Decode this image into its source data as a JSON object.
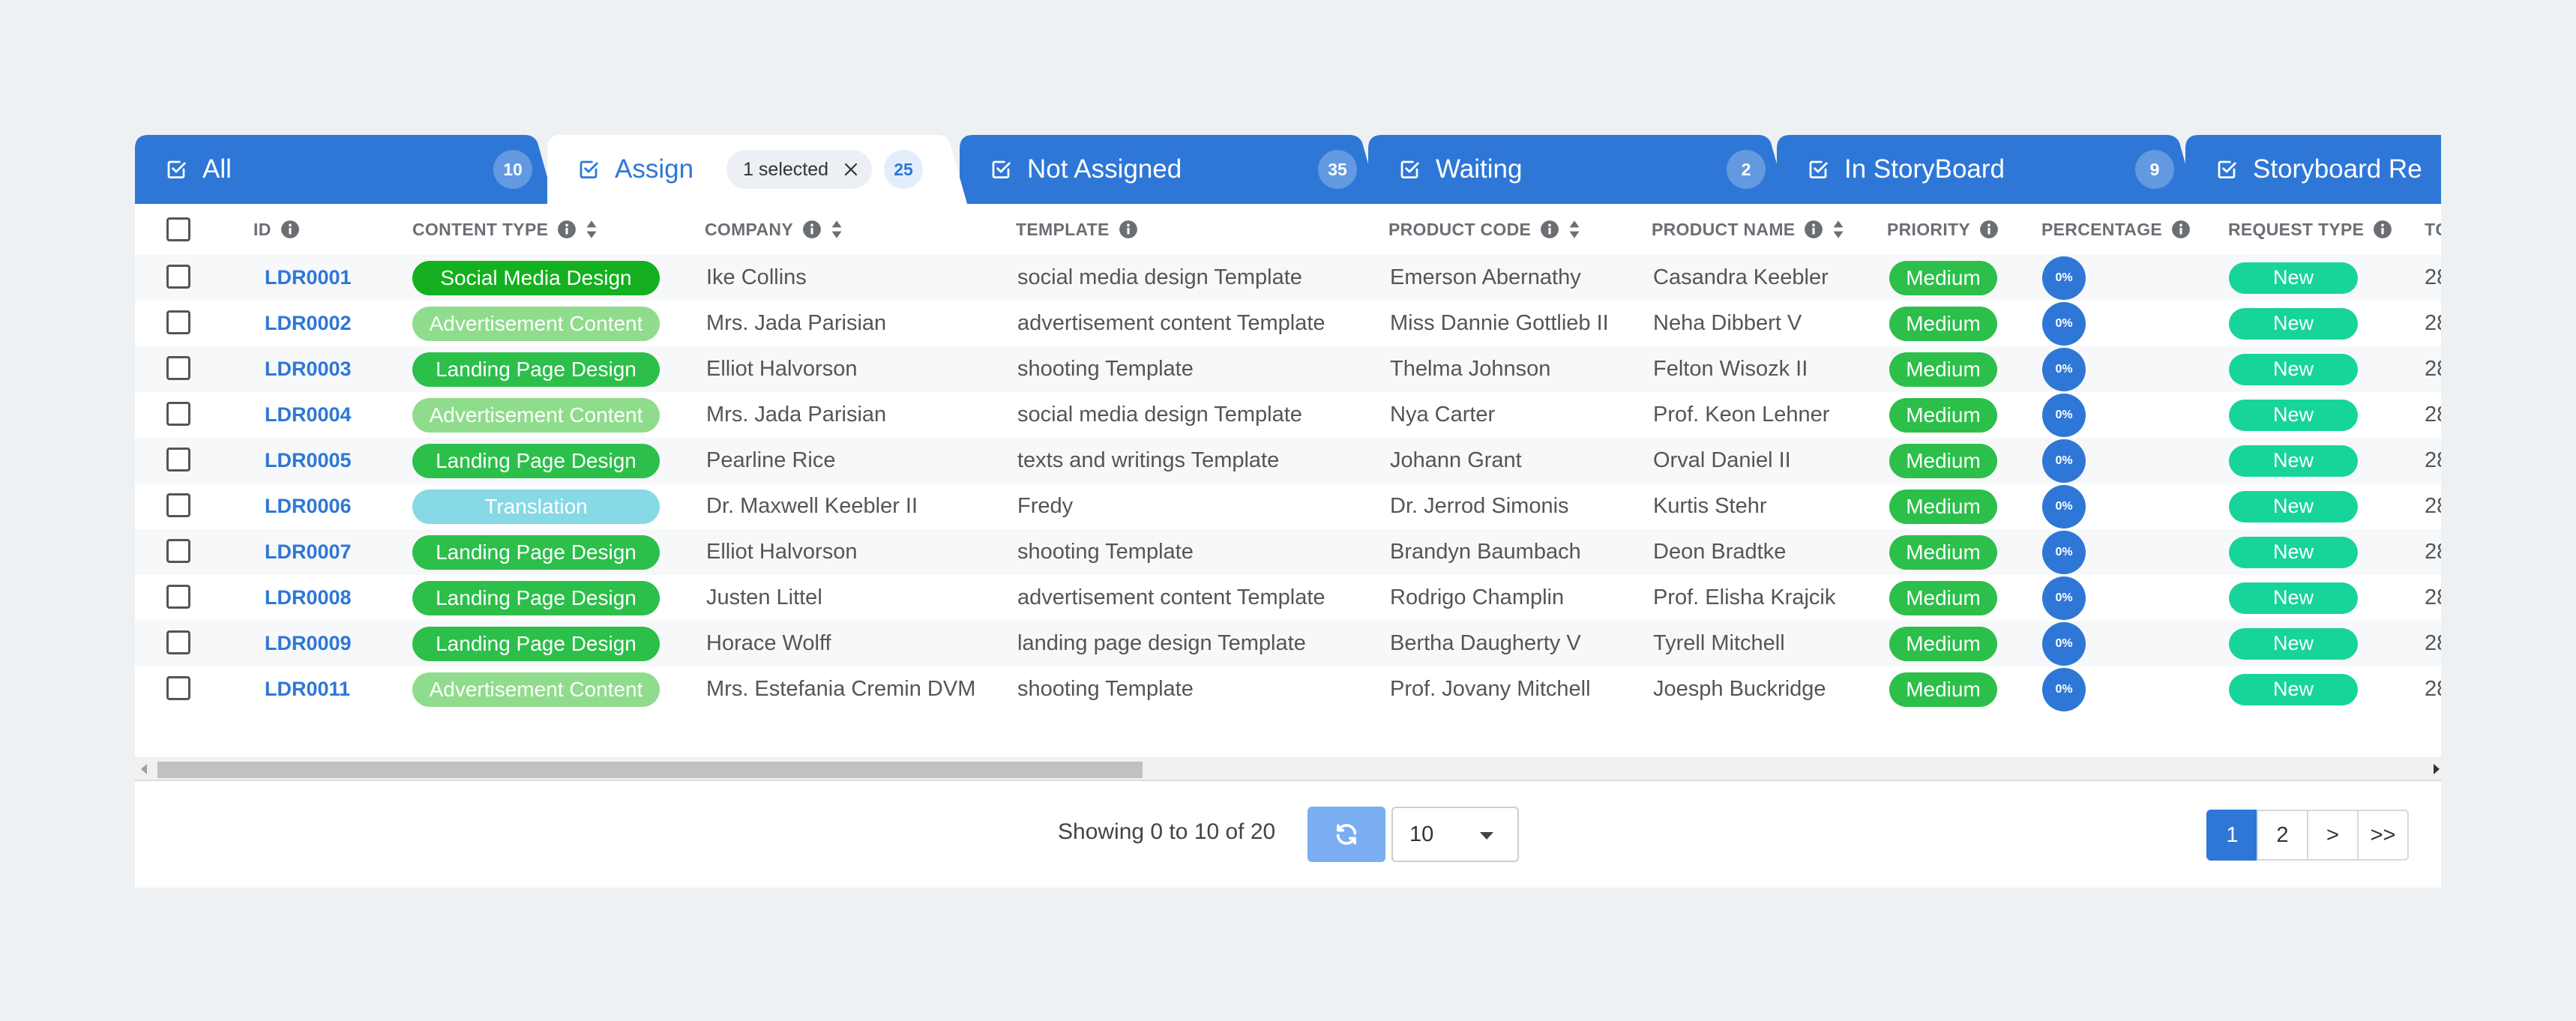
{
  "colors": {
    "tab_blue": "#2e77d6",
    "link_blue": "#2e77d6",
    "ct_dark_green": "#1fb22e",
    "ct_light_green": "#8fdc8c",
    "ct_cyan": "#86d9e5",
    "priority_green": "#2cbf4a",
    "request_teal": "#17d49a",
    "pct_blue": "#2e77d6"
  },
  "tabs": [
    {
      "label": "All",
      "count": "10",
      "active": false,
      "icon": "checkbox-icon"
    },
    {
      "label": "Assign",
      "count": "25",
      "active": true,
      "selected_chip": "1 selected",
      "icon": "checkbox-icon"
    },
    {
      "label": "Not Assigned",
      "count": "35",
      "active": false,
      "icon": "checkbox-icon"
    },
    {
      "label": "Waiting",
      "count": "2",
      "active": false,
      "icon": "checkbox-icon"
    },
    {
      "label": "In StoryBoard",
      "count": "9",
      "active": false,
      "icon": "checkbox-icon"
    },
    {
      "label": "Storyboard Re",
      "count": "",
      "active": false,
      "icon": "checkbox-icon"
    }
  ],
  "table": {
    "columns": [
      {
        "key": "id",
        "label": "ID",
        "info": true,
        "sort": false
      },
      {
        "key": "content_type",
        "label": "CONTENT TYPE",
        "info": true,
        "sort": true
      },
      {
        "key": "company",
        "label": "COMPANY",
        "info": true,
        "sort": true
      },
      {
        "key": "template",
        "label": "TEMPLATE",
        "info": true,
        "sort": false
      },
      {
        "key": "product_code",
        "label": "PRODUCT CODE",
        "info": true,
        "sort": true
      },
      {
        "key": "product_name",
        "label": "PRODUCT NAME",
        "info": true,
        "sort": true
      },
      {
        "key": "priority",
        "label": "PRIORITY",
        "info": true,
        "sort": false
      },
      {
        "key": "percentage",
        "label": "PERCENTAGE",
        "info": true,
        "sort": false
      },
      {
        "key": "request_type",
        "label": "REQUEST TYPE",
        "info": true,
        "sort": false
      },
      {
        "key": "next",
        "label": "TC",
        "info": false,
        "sort": false
      }
    ],
    "rows": [
      {
        "id": "LDR0001",
        "content_type": "Social Media Design",
        "ct_style": "dark",
        "company": "Ike Collins",
        "template": "social media design Template",
        "product_code": "Emerson Abernathy",
        "product_name": "Casandra Keebler",
        "priority": "Medium",
        "percentage": "0%",
        "request_type": "New",
        "next": "28"
      },
      {
        "id": "LDR0002",
        "content_type": "Advertisement Content",
        "ct_style": "light",
        "company": "Mrs. Jada Parisian",
        "template": "advertisement content Template",
        "product_code": "Miss Dannie Gottlieb II",
        "product_name": "Neha Dibbert V",
        "priority": "Medium",
        "percentage": "0%",
        "request_type": "New",
        "next": "28"
      },
      {
        "id": "LDR0003",
        "content_type": "Landing Page Design",
        "ct_style": "mid",
        "company": "Elliot Halvorson",
        "template": "shooting Template",
        "product_code": "Thelma Johnson",
        "product_name": "Felton Wisozk II",
        "priority": "Medium",
        "percentage": "0%",
        "request_type": "New",
        "next": "28"
      },
      {
        "id": "LDR0004",
        "content_type": "Advertisement Content",
        "ct_style": "light",
        "company": "Mrs. Jada Parisian",
        "template": "social media design Template",
        "product_code": "Nya Carter",
        "product_name": "Prof. Keon Lehner",
        "priority": "Medium",
        "percentage": "0%",
        "request_type": "New",
        "next": "28"
      },
      {
        "id": "LDR0005",
        "content_type": "Landing Page Design",
        "ct_style": "mid",
        "company": "Pearline Rice",
        "template": "texts and writings Template",
        "product_code": "Johann Grant",
        "product_name": "Orval Daniel II",
        "priority": "Medium",
        "percentage": "0%",
        "request_type": "New",
        "next": "28"
      },
      {
        "id": "LDR0006",
        "content_type": "Translation",
        "ct_style": "cyan",
        "company": "Dr. Maxwell Keebler II",
        "template": "Fredy",
        "product_code": "Dr. Jerrod Simonis",
        "product_name": "Kurtis Stehr",
        "priority": "Medium",
        "percentage": "0%",
        "request_type": "New",
        "next": "28"
      },
      {
        "id": "LDR0007",
        "content_type": "Landing Page Design",
        "ct_style": "mid",
        "company": "Elliot Halvorson",
        "template": "shooting Template",
        "product_code": "Brandyn Baumbach",
        "product_name": "Deon Bradtke",
        "priority": "Medium",
        "percentage": "0%",
        "request_type": "New",
        "next": "28"
      },
      {
        "id": "LDR0008",
        "content_type": "Landing Page Design",
        "ct_style": "mid",
        "company": "Justen Littel",
        "template": "advertisement content Template",
        "product_code": "Rodrigo Champlin",
        "product_name": "Prof. Elisha Krajcik",
        "priority": "Medium",
        "percentage": "0%",
        "request_type": "New",
        "next": "28"
      },
      {
        "id": "LDR0009",
        "content_type": "Landing Page Design",
        "ct_style": "mid",
        "company": "Horace Wolff",
        "template": "landing page design Template",
        "product_code": "Bertha Daugherty V",
        "product_name": "Tyrell Mitchell",
        "priority": "Medium",
        "percentage": "0%",
        "request_type": "New",
        "next": "28"
      },
      {
        "id": "LDR0011",
        "content_type": "Advertisement Content",
        "ct_style": "light",
        "company": "Mrs. Estefania Cremin DVM",
        "template": "shooting Template",
        "product_code": "Prof. Jovany Mitchell",
        "product_name": "Joesph Buckridge",
        "priority": "Medium",
        "percentage": "0%",
        "request_type": "New",
        "next": "28"
      }
    ]
  },
  "footer": {
    "showing_text": "Showing 0 to 10 of 20",
    "page_size": "10",
    "pages": [
      "1",
      "2",
      ">",
      ">>"
    ],
    "active_page": "1"
  }
}
